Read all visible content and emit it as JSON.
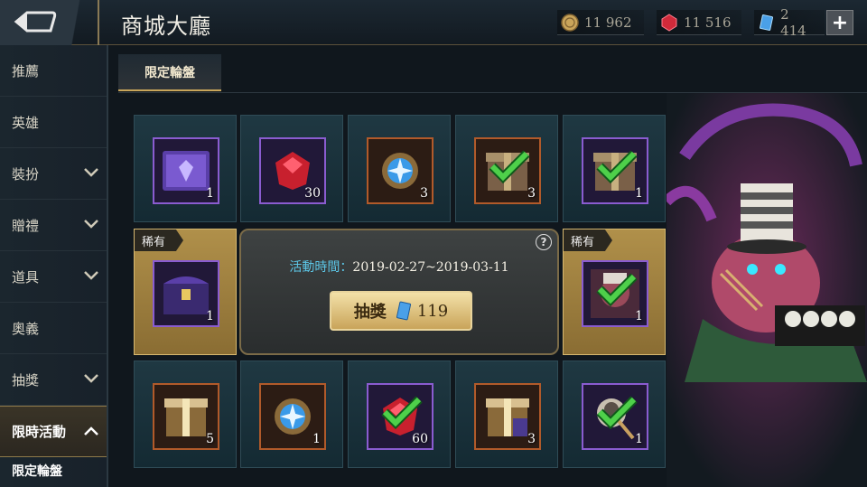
{
  "header": {
    "title": "商城大廳",
    "currencies": [
      {
        "name": "gold",
        "value": "11 962",
        "color": "#c9a45a"
      },
      {
        "name": "diamond",
        "value": "11 516",
        "color": "#d12a3a"
      },
      {
        "name": "voucher",
        "value": "2 414",
        "color": "#4aa0e8"
      }
    ],
    "plus_label": "+"
  },
  "sidebar": {
    "items": [
      {
        "label": "推薦",
        "has_chevron": false
      },
      {
        "label": "英雄",
        "has_chevron": false
      },
      {
        "label": "裝扮",
        "has_chevron": true
      },
      {
        "label": "贈禮",
        "has_chevron": true
      },
      {
        "label": "道具",
        "has_chevron": true
      },
      {
        "label": "奧義",
        "has_chevron": false
      },
      {
        "label": "抽獎",
        "has_chevron": true
      },
      {
        "label": "限時活動",
        "has_chevron": true,
        "active": true
      }
    ],
    "sub_item": "限定輪盤"
  },
  "tabs": [
    {
      "label": "限定輪盤",
      "active": true
    }
  ],
  "wheel": {
    "rare_label": "稀有",
    "items": [
      {
        "icon": "purple-skin-card-icon",
        "qty": "1",
        "claimed": false
      },
      {
        "icon": "red-gem-icon",
        "qty": "30",
        "claimed": false
      },
      {
        "icon": "blue-orb-icon",
        "qty": "3",
        "claimed": false
      },
      {
        "icon": "treasure-box-icon",
        "qty": "3",
        "claimed": true
      },
      {
        "icon": "treasure-box-icon",
        "qty": "1",
        "claimed": true
      },
      {
        "icon": "purple-chest-icon",
        "qty": "1",
        "claimed": false,
        "rare": true
      },
      {
        "icon": "hero-portrait-icon",
        "qty": "1",
        "claimed": true,
        "rare": true
      },
      {
        "icon": "gold-box-icon",
        "qty": "5",
        "claimed": false
      },
      {
        "icon": "blue-orb-icon",
        "qty": "1",
        "claimed": false
      },
      {
        "icon": "red-gem-icon",
        "qty": "60",
        "claimed": true
      },
      {
        "icon": "gold-box-icon",
        "qty": "3",
        "claimed": false
      },
      {
        "icon": "skin-avatar-icon",
        "qty": "1",
        "claimed": true
      }
    ]
  },
  "event": {
    "time_label": "活動時間：",
    "time_value": "2019-02-27~2019-03-11",
    "draw_label": "抽獎",
    "draw_cost": "119"
  }
}
